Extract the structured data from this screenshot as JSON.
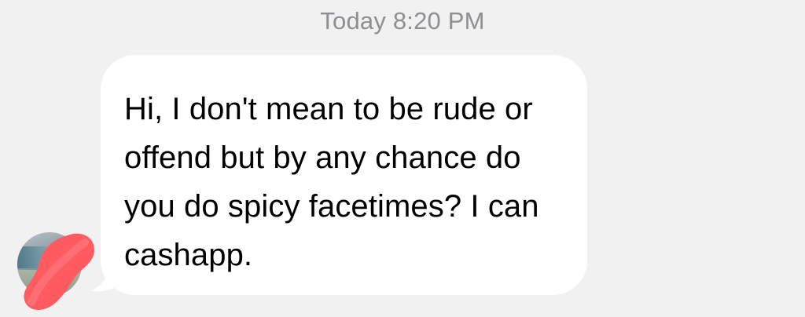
{
  "thread": {
    "timestamp": "Today 8:20 PM"
  },
  "message": {
    "text": "Hi, I don't mean to be rude or offend but by any chance do you do spicy facetimes? I can cashapp.",
    "direction": "incoming",
    "bubble_color": "#ffffff"
  },
  "sender": {
    "avatar_icon": "avatar-photo",
    "redaction_color": "#ff5a5f"
  },
  "colors": {
    "background": "#f1f1f1",
    "timestamp_text": "#8e8e93",
    "message_text": "#000000"
  }
}
